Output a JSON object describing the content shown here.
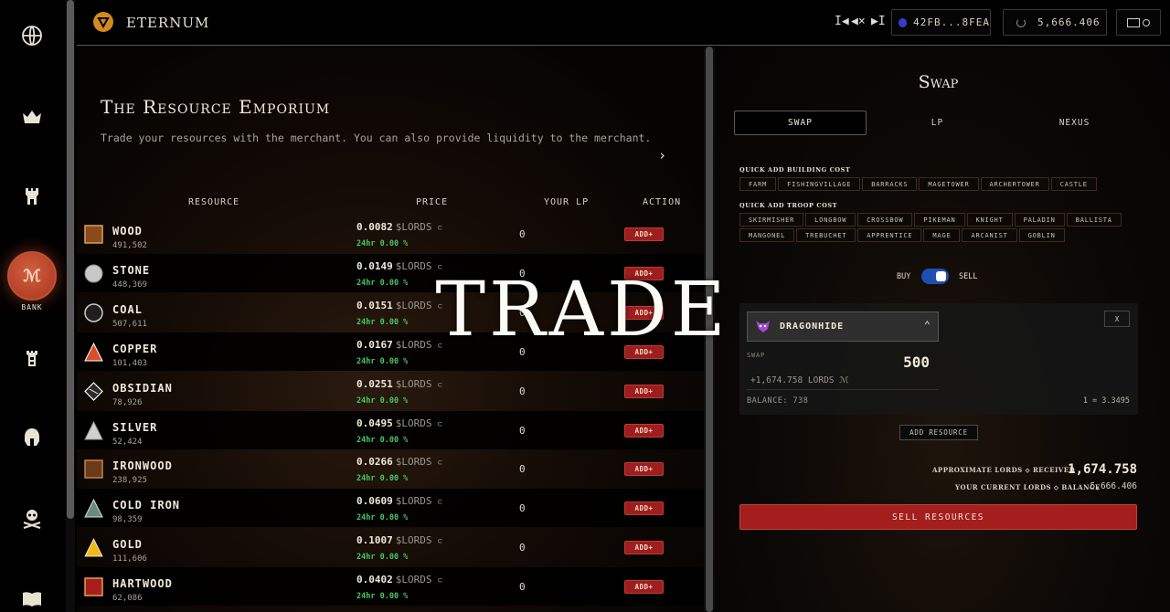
{
  "sidebar": {
    "items": [
      {
        "icon": "globe-icon"
      },
      {
        "icon": "crown-icon"
      },
      {
        "icon": "castle-tower-icon"
      },
      {
        "icon": "bank-icon",
        "label": "BANK",
        "active": true,
        "glyph": "ℳ"
      },
      {
        "icon": "fortress-icon"
      },
      {
        "icon": "helmet-icon"
      },
      {
        "icon": "skull-crossbones-icon"
      },
      {
        "icon": "book-icon"
      }
    ]
  },
  "header": {
    "brand": "ETERNUM",
    "audio": {
      "prev": "I◀",
      "mute": "◀×",
      "next": "▶I"
    },
    "wallet": "42FB...8FEA",
    "lords_balance": "5,666.406"
  },
  "emporium": {
    "title": "The Resource Emporium",
    "subtitle": "Trade your resources with the merchant. You can also provide liquidity to the merchant.",
    "next_arrow": "›",
    "columns": [
      "RESOURCE",
      "PRICE",
      "YOUR LP",
      "ACTION"
    ],
    "rows": [
      {
        "name": "WOOD",
        "amount": "491,502",
        "price": "0.0082",
        "unit": "$LORDS",
        "change": "24hr 0.00 %",
        "lp": "0",
        "action": "ADD+",
        "color": "#8a4a1a",
        "icon": "wood-icon"
      },
      {
        "name": "STONE",
        "amount": "448,369",
        "price": "0.0149",
        "unit": "$LORDS",
        "change": "24hr 0.00 %",
        "lp": "0",
        "action": "ADD+",
        "color": "#c8c8c8",
        "icon": "stone-icon"
      },
      {
        "name": "COAL",
        "amount": "507,611",
        "price": "0.0151",
        "unit": "$LORDS",
        "change": "24hr 0.00 %",
        "lp": "0",
        "action": "ADD+",
        "color": "#1e1e1e",
        "icon": "coal-icon"
      },
      {
        "name": "COPPER",
        "amount": "101,403",
        "price": "0.0167",
        "unit": "$LORDS",
        "change": "24hr 0.00 %",
        "lp": "0",
        "action": "ADD+",
        "color": "#d8502a",
        "icon": "copper-icon"
      },
      {
        "name": "OBSIDIAN",
        "amount": "78,926",
        "price": "0.0251",
        "unit": "$LORDS",
        "change": "24hr 0.00 %",
        "lp": "0",
        "action": "ADD+",
        "color": "#2a2a2a",
        "icon": "obsidian-icon"
      },
      {
        "name": "SILVER",
        "amount": "52,424",
        "price": "0.0495",
        "unit": "$LORDS",
        "change": "24hr 0.00 %",
        "lp": "0",
        "action": "ADD+",
        "color": "#d0d0d0",
        "icon": "silver-icon"
      },
      {
        "name": "IRONWOOD",
        "amount": "238,925",
        "price": "0.0266",
        "unit": "$LORDS",
        "change": "24hr 0.00 %",
        "lp": "0",
        "action": "ADD+",
        "color": "#6a3a1a",
        "icon": "ironwood-icon"
      },
      {
        "name": "COLD IRON",
        "amount": "98,359",
        "price": "0.0609",
        "unit": "$LORDS",
        "change": "24hr 0.00 %",
        "lp": "0",
        "action": "ADD+",
        "color": "#6a8a80",
        "icon": "cold-iron-icon"
      },
      {
        "name": "GOLD",
        "amount": "111,606",
        "price": "0.1007",
        "unit": "$LORDS",
        "change": "24hr 0.00 %",
        "lp": "0",
        "action": "ADD+",
        "color": "#f0b818",
        "icon": "gold-icon"
      },
      {
        "name": "HARTWOOD",
        "amount": "62,086",
        "price": "0.0402",
        "unit": "$LORDS",
        "change": "24hr 0.00 %",
        "lp": "0",
        "action": "ADD+",
        "color": "#a81e1e",
        "icon": "hartwood-icon"
      }
    ]
  },
  "swap": {
    "title": "Swap",
    "tabs": [
      "SWAP",
      "LP",
      "NEXUS"
    ],
    "active_tab": "SWAP",
    "building_label": "QUICK ADD BUILDING COST",
    "building_chips": [
      "FARM",
      "FISHINGVILLAGE",
      "BARRACKS",
      "MAGETOWER",
      "ARCHERTOWER",
      "CASTLE"
    ],
    "troop_label": "QUICK ADD TROOP COST",
    "troop_chips": [
      "SKIRMISHER",
      "LONGBOW",
      "CROSSBOW",
      "PIKEMAN",
      "KNIGHT",
      "PALADIN",
      "BALLISTA",
      "MANGONEL",
      "TREBUCHET",
      "APPRENTICE",
      "MAGE",
      "ARCANIST",
      "GOBLIN"
    ],
    "buy_label": "BUY",
    "sell_label": "SELL",
    "mode": "SELL",
    "card": {
      "resource": "DRAGONHIDE",
      "close_label": "X",
      "swap_label": "SWAP",
      "amount": "500",
      "output": "+1,674.758 LORDS ℳ",
      "balance": "BALANCE: 738",
      "rate": "1 = 3.3495"
    },
    "add_resource_label": "ADD RESOURCE",
    "approx_label": "APPROXIMATE LORDS ⬦ RECEIVED",
    "approx_value": "1,674.758",
    "current_label": "YOUR CURRENT LORDS ⬦ BALANCE",
    "current_value": "5,666.406",
    "sell_button": "SELL RESOURCES"
  },
  "overlay": {
    "text": "TRADE"
  },
  "colors": {
    "accent_red": "#a41e1e",
    "positive": "#48c860",
    "toggle": "#1e4fb0",
    "brand": "#d28a1e"
  }
}
